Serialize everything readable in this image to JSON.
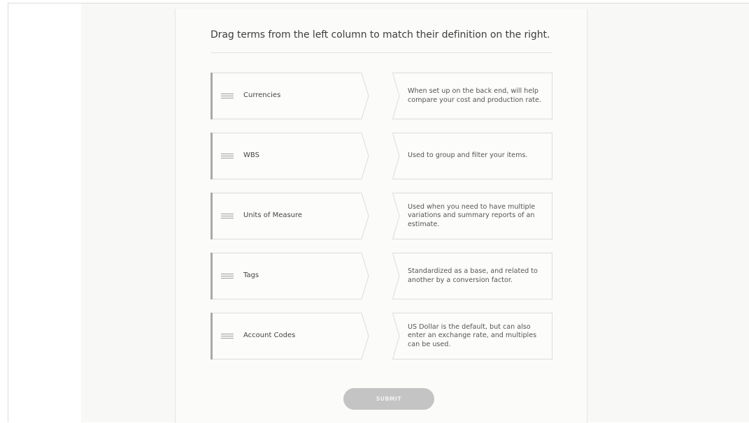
{
  "instructions": "Drag terms from the left column to match their definition on the right.",
  "terms": [
    {
      "label": "Currencies"
    },
    {
      "label": "WBS"
    },
    {
      "label": "Units of Measure"
    },
    {
      "label": "Tags"
    },
    {
      "label": "Account Codes"
    }
  ],
  "definitions": [
    {
      "text": "When set up on the back end, will help compare your cost and production rate."
    },
    {
      "text": "Used to group and filter your items."
    },
    {
      "text": "Used when you need to have multiple variations and summary reports of an estimate."
    },
    {
      "text": "Standardized as a base, and related to another by a conversion factor."
    },
    {
      "text": "US Dollar is the default, but can also enter an exchange rate, and multiples can be used."
    }
  ],
  "submit_label": "SUBMIT",
  "icons": {
    "drag_handle": "drag-handle-icon"
  },
  "colors": {
    "term_accent": "#a9a9a9",
    "submit_bg": "#c4c4c4",
    "card_bg": "#fbfbf9"
  }
}
